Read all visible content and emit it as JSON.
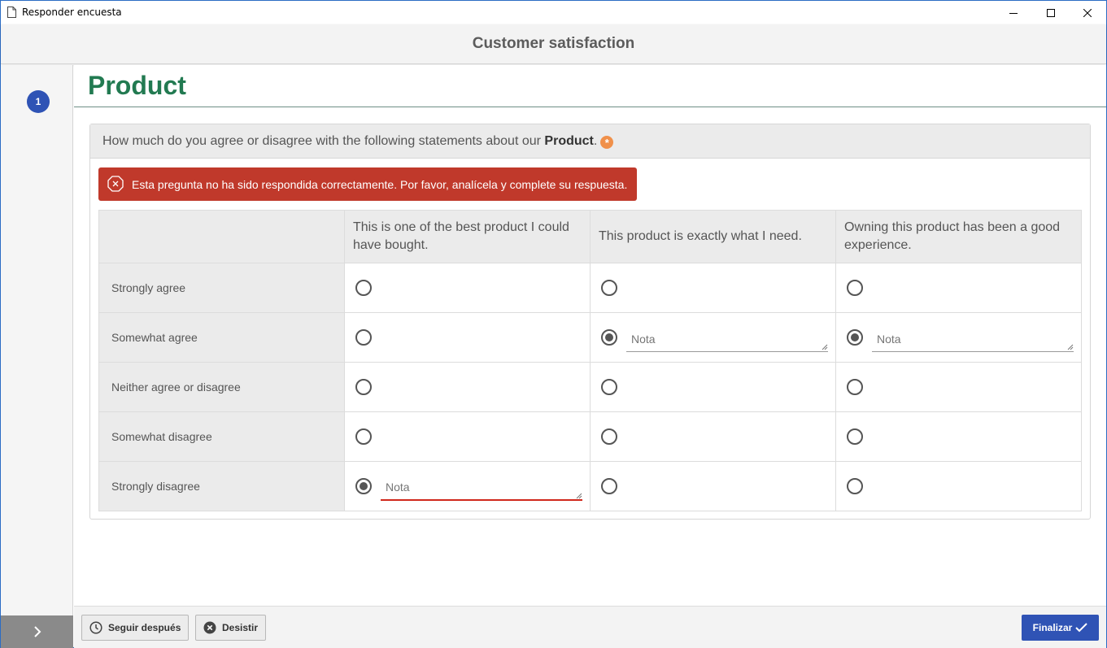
{
  "window": {
    "title": "Responder encuesta"
  },
  "survey": {
    "title": "Customer satisfaction"
  },
  "sidebar": {
    "step": "1"
  },
  "section": {
    "title": "Product"
  },
  "question": {
    "text_prefix": "How much do you agree or disagree with the following statements about our ",
    "text_bold": "Product",
    "text_suffix": ".",
    "required_mark": "*",
    "error": "Esta pregunta no ha sido respondida correctamente. Por favor, analícela y complete su respuesta."
  },
  "matrix": {
    "columns": [
      "This is one of the best product I could have bought.",
      "This product is exactly what I need.",
      "Owning this product has been a good experience."
    ],
    "rows": [
      "Strongly agree",
      "Somewhat agree",
      "Neither agree or disagree",
      "Somewhat disagree",
      "Strongly disagree"
    ],
    "selected": {
      "This is one of the best product I could have bought.": "Strongly disagree",
      "This product is exactly what I need.": "Somewhat agree",
      "Owning this product has been a good experience.": "Somewhat agree"
    },
    "note_placeholder": "Nota"
  },
  "footer": {
    "later_label": "Seguir después",
    "cancel_label": "Desistir",
    "finish_label": "Finalizar"
  },
  "colors": {
    "accent": "#2f53b5",
    "section_title": "#227a51",
    "error_bg": "#c0392b",
    "required": "#f0904a"
  }
}
